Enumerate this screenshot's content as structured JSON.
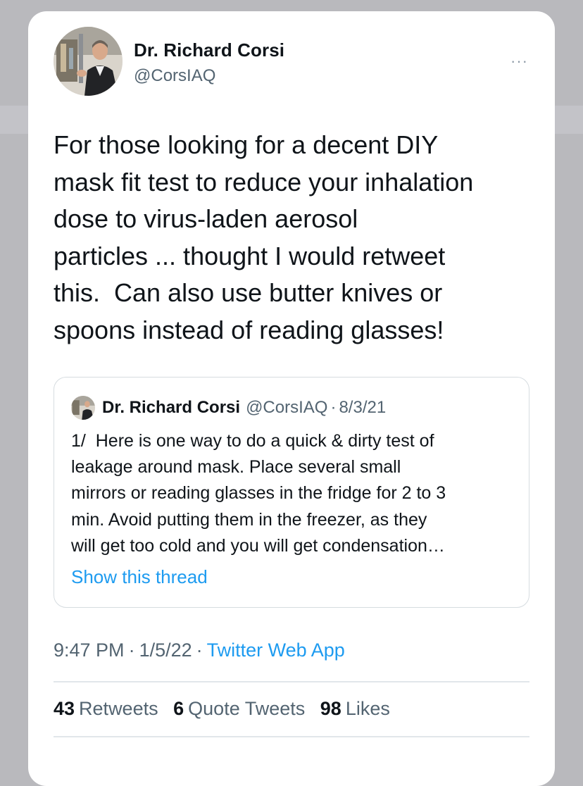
{
  "tweet": {
    "author": {
      "name": "Dr. Richard Corsi",
      "handle": "@CorsIAQ"
    },
    "more_icon": "···",
    "text": "For those looking for a decent DIY\nmask fit test to reduce your inhalation\ndose to virus-laden aerosol\nparticles ... thought I would retweet\nthis.  Can also use butter knives or\nspoons instead of reading glasses!",
    "quoted": {
      "name": "Dr. Richard Corsi",
      "handle": "@CorsIAQ",
      "separator": "·",
      "date": "8/3/21",
      "text": "1/  Here is one way to do a quick & dirty test of\nleakage around mask. Place several small\nmirrors or reading glasses in the fridge for 2 to 3\nmin. Avoid putting them in the freezer, as they\nwill get too cold and you will get condensation…",
      "show_thread": "Show this thread"
    },
    "meta": {
      "time": "9:47 PM",
      "separator": "·",
      "date": "1/5/22",
      "source": "Twitter Web App"
    },
    "stats": {
      "retweets_count": "43",
      "retweets_label": "Retweets",
      "quotes_count": "6",
      "quotes_label": "Quote Tweets",
      "likes_count": "98",
      "likes_label": "Likes"
    }
  },
  "icons": {
    "avatar": "profile-photo",
    "more": "more-options-icon"
  },
  "colors": {
    "link": "#1d9bf0",
    "text": "#0f1419",
    "secondary": "#536471",
    "border": "#d6dce0"
  }
}
